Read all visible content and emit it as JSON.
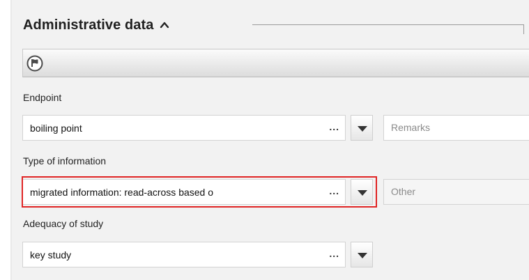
{
  "section": {
    "title": "Administrative data"
  },
  "toolbar": {
    "flag_icon": "flag-icon"
  },
  "endpoint": {
    "label": "Endpoint",
    "value": "boiling point",
    "ellipsis": "...",
    "remarks_placeholder": "Remarks"
  },
  "type_of_information": {
    "label": "Type of information",
    "value": "migrated information: read-across based o",
    "ellipsis": "...",
    "other_placeholder": "Other"
  },
  "adequacy_of_study": {
    "label": "Adequacy of study",
    "value": "key study",
    "ellipsis": "..."
  },
  "colors": {
    "highlight": "#e02424",
    "panel": "#f2f2f2"
  }
}
